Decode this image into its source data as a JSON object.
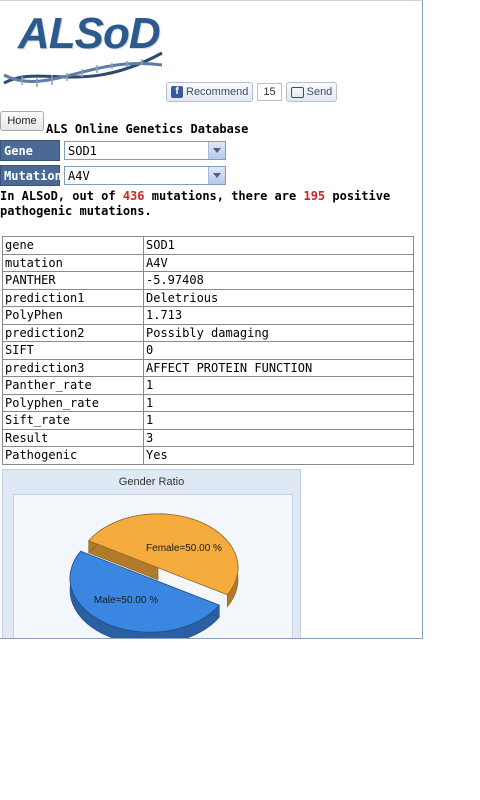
{
  "logo": {
    "text": "ALSoD"
  },
  "social": {
    "recommend_label": "Recommend",
    "count": "15",
    "send_label": "Send"
  },
  "nav": {
    "home_label": "Home"
  },
  "page": {
    "title": "ALS Online Genetics Database"
  },
  "selectors": {
    "gene": {
      "label": "Gene",
      "value": "SOD1"
    },
    "mutation": {
      "label": "Mutation",
      "value": "A4V"
    }
  },
  "summary": {
    "part1": "In ALSoD, out of ",
    "total": "436",
    "part2": " mutations, there are ",
    "positive": "195",
    "part3": " positive pathogenic mutations."
  },
  "table": {
    "rows": [
      {
        "key": "gene",
        "value": "SOD1"
      },
      {
        "key": "mutation",
        "value": "A4V"
      },
      {
        "key": "PANTHER",
        "value": "-5.97408"
      },
      {
        "key": "prediction1",
        "value": "Deletrious"
      },
      {
        "key": "PolyPhen",
        "value": "1.713"
      },
      {
        "key": "prediction2",
        "value": "Possibly damaging"
      },
      {
        "key": "SIFT",
        "value": "0"
      },
      {
        "key": "prediction3",
        "value": "AFFECT PROTEIN FUNCTION"
      },
      {
        "key": "Panther_rate",
        "value": "1"
      },
      {
        "key": "Polyphen_rate",
        "value": "1"
      },
      {
        "key": "Sift_rate",
        "value": "1"
      },
      {
        "key": "Result",
        "value": "3"
      },
      {
        "key": "Pathogenic",
        "value": "Yes"
      }
    ]
  },
  "chart_data": {
    "type": "pie",
    "title": "Gender Ratio",
    "categories": [
      "Female",
      "Male"
    ],
    "values": [
      50.0,
      50.0
    ],
    "labels": [
      "Female=50.00 %",
      "Male=50.00 %"
    ],
    "colors": [
      "#f5ac3c",
      "#3a86e0"
    ]
  }
}
